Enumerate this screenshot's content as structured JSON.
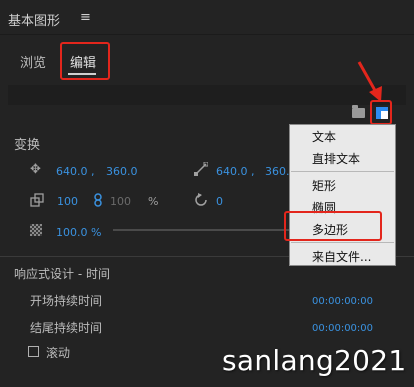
{
  "panel": {
    "title": "基本图形",
    "menu_glyph": "≡"
  },
  "tabs": [
    {
      "label": "浏览"
    },
    {
      "label": "编辑"
    }
  ],
  "transform": {
    "title": "变换",
    "position": {
      "x": "640.0",
      "comma": ",",
      "y": "360.0"
    },
    "anchor": {
      "x": "640.0",
      "comma": ",",
      "y": "360.0"
    },
    "scale": {
      "w": "100",
      "h": "100",
      "unit": "%"
    },
    "rotation": "0",
    "opacity": "100.0 %"
  },
  "responsive": {
    "title": "响应式设计 - 时间",
    "intro_label": "开场持续时间",
    "intro_value": "00:00:00:00",
    "outro_label": "结尾持续时间",
    "outro_value": "00:00:00:00",
    "roll_label": "滚动"
  },
  "menu": {
    "items": [
      "文本",
      "直排文本",
      "矩形",
      "椭圆",
      "多边形",
      "来自文件..."
    ]
  },
  "colors": {
    "accent_blue": "#3a92e0",
    "highlight_red": "#e3261c"
  },
  "watermark": "sanlang2021"
}
